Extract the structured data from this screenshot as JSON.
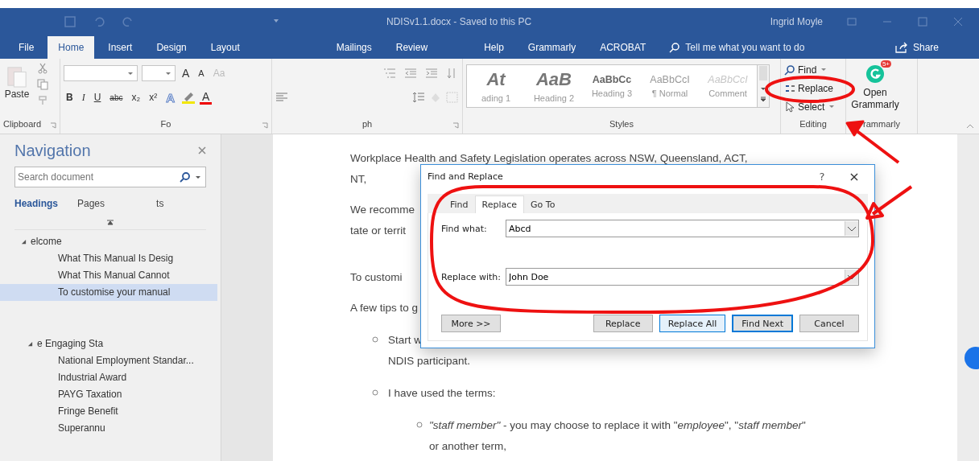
{
  "window": {
    "title": "NDISv1.1.docx - Saved to this PC",
    "user": "Ingrid Moyle"
  },
  "tabs": [
    {
      "label": "File",
      "selected": false
    },
    {
      "label": "Home",
      "selected": true
    },
    {
      "label": "Insert",
      "selected": false
    },
    {
      "label": "Design",
      "selected": false
    },
    {
      "label": "Layout",
      "selected": false
    },
    {
      "label": "Mailings",
      "selected": false
    },
    {
      "label": "Review",
      "selected": false
    },
    {
      "label": "Help",
      "selected": false
    },
    {
      "label": "Grammarly",
      "selected": false
    },
    {
      "label": "ACROBAT",
      "selected": false
    }
  ],
  "tell_me": {
    "placeholder": "Tell me what you want to do"
  },
  "share": "Share",
  "ribbon": {
    "clipboard": {
      "paste": "Paste",
      "label": "Clipboard"
    },
    "font": {
      "grow": "A",
      "shrink": "A",
      "case": "Aa",
      "buttons": [
        "B",
        "I",
        "U",
        "abc",
        "x₂",
        "x²"
      ],
      "effects": "A",
      "color_button": "A",
      "label": "Fo"
    },
    "paragraph": {
      "label": "ph"
    },
    "styles": {
      "label": "Styles",
      "items": [
        {
          "preview": "At",
          "name": "ading 1",
          "kind": "heading"
        },
        {
          "preview": "AaB",
          "name": "Heading 2",
          "kind": "heading"
        },
        {
          "preview": "AaBbCc",
          "name": "Heading 3",
          "kind": "sub"
        },
        {
          "preview": "AaBbCcI",
          "name": "¶ Normal",
          "kind": "normal"
        },
        {
          "preview": "AaBbCcI",
          "name": "Comment",
          "kind": "comment"
        }
      ]
    },
    "editing": {
      "label": "Editing",
      "find": "Find",
      "replace": "Replace",
      "select": "Select"
    },
    "grammarly": {
      "label": "rammarly",
      "button": "Open Grammarly",
      "badge": "5+"
    }
  },
  "navigation": {
    "title": "Navigation",
    "search": {
      "placeholder": "Search document"
    },
    "tabs": [
      {
        "label": "Headings",
        "selected": true
      },
      {
        "label": "Pages",
        "selected": false
      },
      {
        "label": "ts",
        "selected": false
      }
    ],
    "headings": [
      {
        "label": "elcome",
        "expanded": true,
        "selected": false,
        "children": [
          {
            "label": "What This Manual Is Desig",
            "selected": false
          },
          {
            "label": "What This Manual Cannot",
            "selected": false
          },
          {
            "label": "To customise your manual",
            "selected": true
          }
        ]
      },
      {
        "label": "e Engaging Sta",
        "expanded": true,
        "selected": false,
        "children": [
          {
            "label": "National Employment Standar...",
            "selected": false
          },
          {
            "label": "Industrial Award",
            "selected": false
          },
          {
            "label": "PAYG Taxation",
            "selected": false
          },
          {
            "label": "Fringe Benefit",
            "selected": false
          },
          {
            "label": "Superannu",
            "selected": false
          }
        ]
      }
    ]
  },
  "document": {
    "lines": [
      {
        "kind": "para",
        "text": "Workplace Health and Safety Legislation operates across NSW, Queensland, ACT,"
      },
      {
        "kind": "cont",
        "text": "NT,"
      },
      {
        "kind": "para",
        "text": "We recomme"
      },
      {
        "kind": "cont",
        "text": "tate or territ"
      },
      {
        "kind": "gap",
        "text": "To customi"
      },
      {
        "kind": "para",
        "text": "A few tips to g"
      },
      {
        "kind": "bullet",
        "text": "Start w"
      },
      {
        "kind": "bullet_cont",
        "text": "NDIS participant."
      },
      {
        "kind": "bullet",
        "text": "I have used the terms:"
      },
      {
        "kind": "sub_bullet",
        "text": "*\"staff member\"* - you may choose to replace it with \"*employee*\", \"*staff member*\""
      },
      {
        "kind": "sub_cont",
        "text": "or another term,"
      }
    ]
  },
  "dialog": {
    "title": "Find and Replace",
    "help": "?",
    "close": "×",
    "tabs": [
      {
        "label": "Find",
        "selected": false
      },
      {
        "label": "Replace",
        "selected": true
      },
      {
        "label": "Go To",
        "selected": false
      }
    ],
    "fields": [
      {
        "label": "Find what:",
        "value": "Abcd"
      },
      {
        "label": "Replace with:",
        "value": "John Doe"
      }
    ],
    "more": "More >>",
    "buttons": [
      {
        "label": "Replace",
        "default": false
      },
      {
        "label": "Replace All",
        "default": false
      },
      {
        "label": "Find Next",
        "default": true
      },
      {
        "label": "Cancel",
        "default": false
      }
    ]
  }
}
